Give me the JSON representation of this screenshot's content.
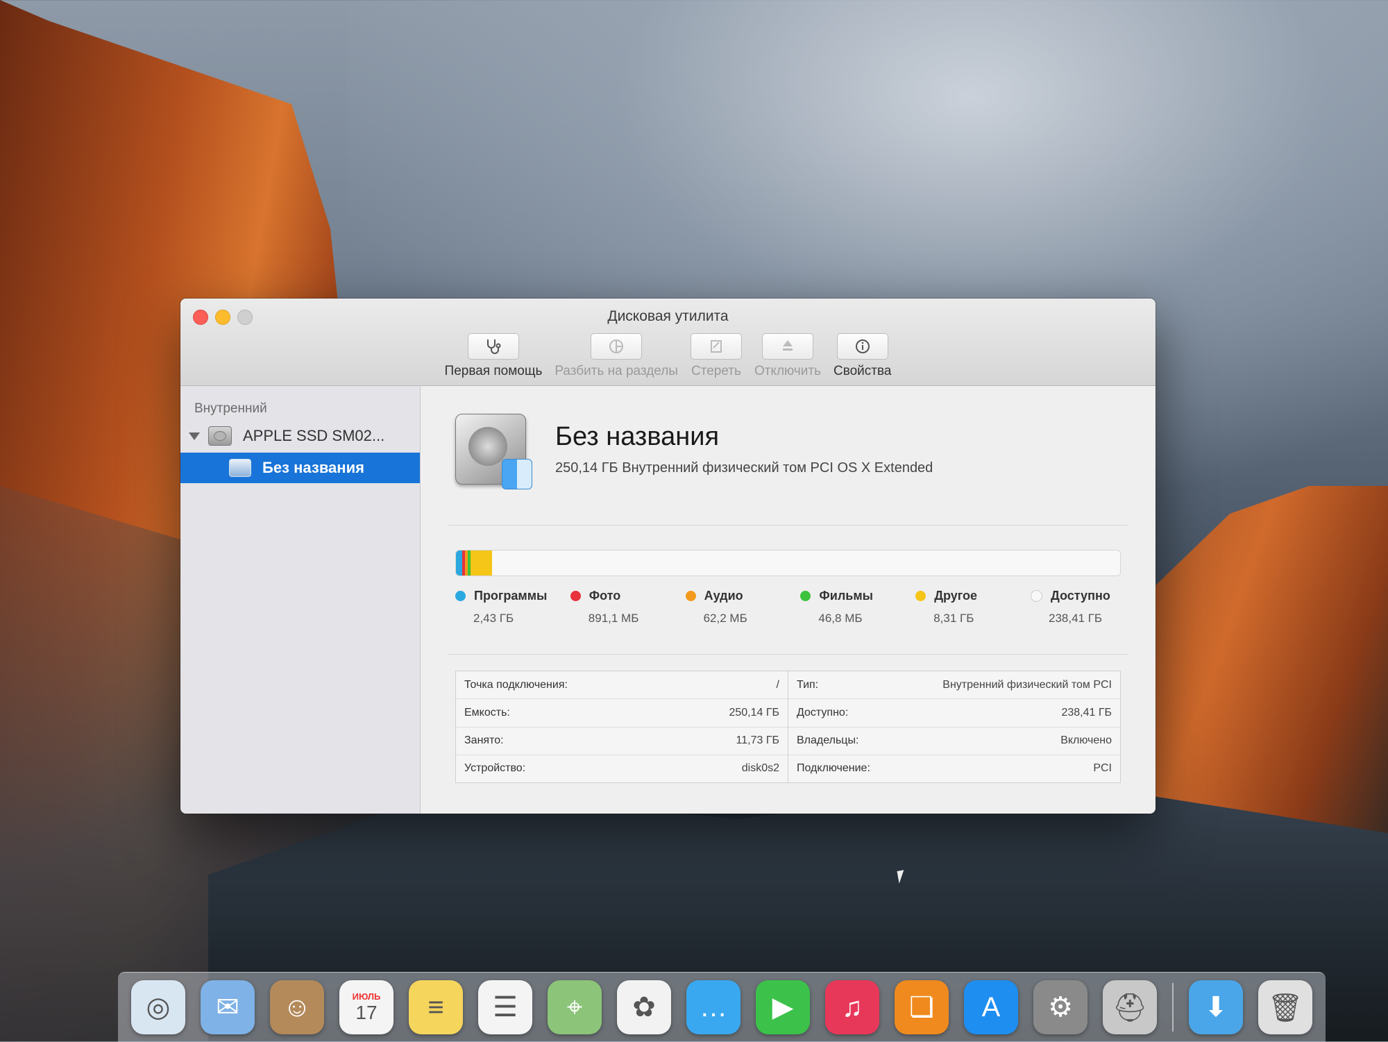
{
  "window": {
    "title": "Дисковая утилита"
  },
  "toolbar": {
    "items": [
      {
        "label": "Первая помощь",
        "icon": "stethoscope-icon",
        "enabled": true
      },
      {
        "label": "Разбить на разделы",
        "icon": "partition-icon",
        "enabled": false
      },
      {
        "label": "Стереть",
        "icon": "erase-icon",
        "enabled": false
      },
      {
        "label": "Отключить",
        "icon": "unmount-icon",
        "enabled": false
      },
      {
        "label": "Свойства",
        "icon": "info-icon",
        "enabled": true
      }
    ]
  },
  "sidebar": {
    "section": "Внутренний",
    "disk": "APPLE SSD SM02...",
    "volume": "Без названия"
  },
  "volume": {
    "name": "Без названия",
    "subtitle": "250,14 ГБ Внутренний физический том PCI OS X Extended"
  },
  "usage": [
    {
      "label": "Программы",
      "value": "2,43 ГБ",
      "color": "#2aa8e0",
      "fraction": 0.0097
    },
    {
      "label": "Фото",
      "value": "891,1 МБ",
      "color": "#e8323c",
      "fraction": 0.0036
    },
    {
      "label": "Аудио",
      "value": "62,2 МБ",
      "color": "#f39a1e",
      "fraction": 0.0003
    },
    {
      "label": "Фильмы",
      "value": "46,8 МБ",
      "color": "#3cc23c",
      "fraction": 0.0002
    },
    {
      "label": "Другое",
      "value": "8,31 ГБ",
      "color": "#f5c518",
      "fraction": 0.0332
    },
    {
      "label": "Доступно",
      "value": "238,41 ГБ",
      "color": "#f8f8f8",
      "fraction": 0.953
    }
  ],
  "info": {
    "left": [
      {
        "label": "Точка подключения:",
        "value": "/"
      },
      {
        "label": "Емкость:",
        "value": "250,14 ГБ"
      },
      {
        "label": "Занято:",
        "value": "11,73 ГБ"
      },
      {
        "label": "Устройство:",
        "value": "disk0s2"
      }
    ],
    "right": [
      {
        "label": "Тип:",
        "value": "Внутренний физический том PCI"
      },
      {
        "label": "Доступно:",
        "value": "238,41 ГБ"
      },
      {
        "label": "Владельцы:",
        "value": "Включено"
      },
      {
        "label": "Подключение:",
        "value": "PCI"
      }
    ]
  },
  "dock": {
    "calendar_month": "ИЮЛЬ",
    "items": [
      {
        "name": "safari-icon",
        "color": "#d8e6f2",
        "glyph": "◎"
      },
      {
        "name": "mail-icon",
        "color": "#7fb2e6",
        "glyph": "✉"
      },
      {
        "name": "contacts-icon",
        "color": "#b48a5a",
        "glyph": "☺"
      },
      {
        "name": "calendar-icon",
        "color": "#f4f4f4",
        "glyph": "17"
      },
      {
        "name": "notes-icon",
        "color": "#f6d55c",
        "glyph": "≡"
      },
      {
        "name": "reminders-icon",
        "color": "#f4f4f4",
        "glyph": "☰"
      },
      {
        "name": "maps-icon",
        "color": "#8cc47a",
        "glyph": "⌖"
      },
      {
        "name": "photos-icon",
        "color": "#f2f2f2",
        "glyph": "✿"
      },
      {
        "name": "messages-icon",
        "color": "#3aa8f0",
        "glyph": "…"
      },
      {
        "name": "facetime-icon",
        "color": "#3cc24a",
        "glyph": "▶"
      },
      {
        "name": "itunes-icon",
        "color": "#e8385a",
        "glyph": "♫"
      },
      {
        "name": "ibooks-icon",
        "color": "#f08a1e",
        "glyph": "❏"
      },
      {
        "name": "app-store-icon",
        "color": "#1e8ef0",
        "glyph": "A"
      },
      {
        "name": "system-preferences-icon",
        "color": "#8a8a8a",
        "glyph": "⚙"
      },
      {
        "name": "disk-utility-icon",
        "color": "#c8c8c8",
        "glyph": "⛑"
      },
      {
        "name": "downloads-folder-icon",
        "color": "#4aa6e8",
        "glyph": "⬇"
      },
      {
        "name": "trash-icon",
        "color": "#e0e0e0",
        "glyph": "🗑"
      }
    ]
  }
}
